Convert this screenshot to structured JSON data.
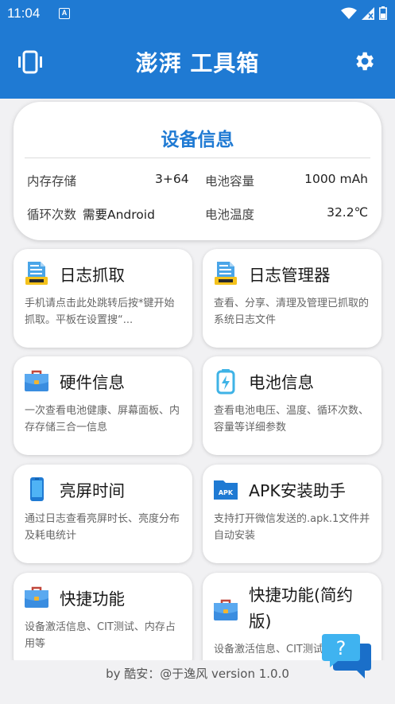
{
  "status": {
    "time": "11:04",
    "a_icon_text": "A"
  },
  "appbar": {
    "title": "澎湃 工具箱",
    "left_icon": "vibrate-icon",
    "right_icon": "gear-icon"
  },
  "device": {
    "title": "设备信息",
    "memory_label": "内存存储",
    "memory_value": "3+64",
    "capacity_label": "电池容量",
    "capacity_value": "1000 mAh",
    "cycles_label": "循环次数",
    "cycles_value": "需要Android",
    "temp_label": "电池温度",
    "temp_value": "32.2℃"
  },
  "tools": [
    {
      "title": "日志抓取",
      "desc": "手机请点击此处跳转后按*键开始抓取。平板在设置搜“...",
      "icon": "logs-icon"
    },
    {
      "title": "日志管理器",
      "desc": "查看、分享、清理及管理已抓取的系统日志文件",
      "icon": "logs-icon"
    },
    {
      "title": "硬件信息",
      "desc": "一次查看电池健康、屏幕面板、内存存储三合一信息",
      "icon": "toolbox-icon"
    },
    {
      "title": "电池信息",
      "desc": "查看电池电压、温度、循环次数、容量等详细参数",
      "icon": "battery-icon"
    },
    {
      "title": "亮屏时间",
      "desc": "通过日志查看亮屏时长、亮度分布及耗电统计",
      "icon": "phone-icon"
    },
    {
      "title": "APK安装助手",
      "desc": "支持打开微信发送的.apk.1文件并自动安装",
      "icon": "apk-folder-icon",
      "icon_text": "APK"
    },
    {
      "title": "快捷功能",
      "desc": "设备激活信息、CIT测试、内存占用等",
      "icon": "toolbox-icon"
    },
    {
      "title": "快捷功能(简约版)",
      "title_line1": "快捷功能(简约",
      "title_line2": "版)",
      "desc": "设备激活信息、CIT测试",
      "icon": "toolbox-icon"
    }
  ],
  "footer": {
    "text": "by 酷安：@于逸风 version 1.0.0"
  },
  "colors": {
    "primary": "#1f7ad3",
    "background": "#f1f1f3",
    "card": "#ffffff"
  }
}
